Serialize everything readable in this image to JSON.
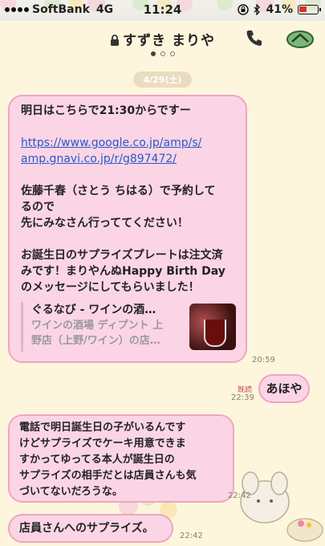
{
  "status": {
    "carrier": "SoftBank",
    "network": "4G",
    "time": "11:24",
    "battery": "41%",
    "battery_level": 0.41
  },
  "header": {
    "contact_name": "すずき まりや",
    "page_dots": [
      true,
      false,
      false
    ]
  },
  "date_divider": "4/29(土)",
  "messages": [
    {
      "lines": [
        "明日はこちらで21:30からですー"
      ],
      "link_lines": [
        "https://www.google.co.jp/amp/s/",
        "amp.gnavi.co.jp/r/g897472/"
      ],
      "lines2": [
        "佐藤千春（さとう ちはる）で予約して",
        "るので",
        "先にみなさん行っててください！"
      ],
      "lines3": [
        "お誕生日のサプライズプレートは注文済",
        "みです！まりやんぬHappy Birth Day",
        "のメッセージにしてもらいました！"
      ],
      "preview": {
        "title": "ぐるなび - ワインの酒…",
        "desc": [
          "ワインの酒場 ディプント 上",
          "野店（上野/ワイン）の店…"
        ]
      },
      "time": "20:59"
    },
    {
      "text": "あほや",
      "read": "既読",
      "time": "22:39"
    },
    {
      "lines": [
        "電話で明日誕生日の子がいるんです",
        "けどサプライズでケーキ用意できま",
        "すかってゆってる本人が誕生日の",
        "サプライズの相手だとは店員さんも気",
        "づいてないだろうな。"
      ],
      "time": "22:42"
    },
    {
      "text": "店員さんへのサプライズ。",
      "time": "22:42"
    }
  ],
  "icons": {
    "lock": "lock-icon",
    "phone": "phone-icon",
    "menu": "menu-chevron-icon",
    "bluetooth": "bluetooth-icon",
    "alarm": "rotation-lock-icon"
  }
}
